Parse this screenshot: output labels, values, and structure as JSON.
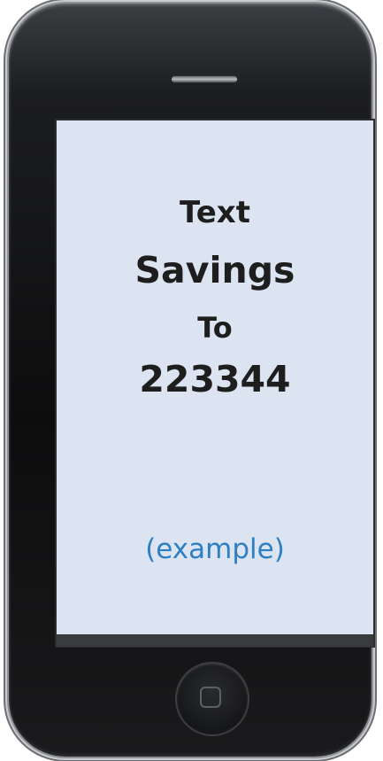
{
  "screen": {
    "line1": "Text",
    "line2": "Savings",
    "line3": "To",
    "line4": "223344",
    "example_label": "(example)"
  },
  "colors": {
    "screen_background": "#dbe4f0",
    "text_color": "#1e1e1e",
    "example_color": "#2e7fc4"
  },
  "icons": {
    "speaker": "speaker-grille-icon",
    "home": "home-button-icon"
  }
}
